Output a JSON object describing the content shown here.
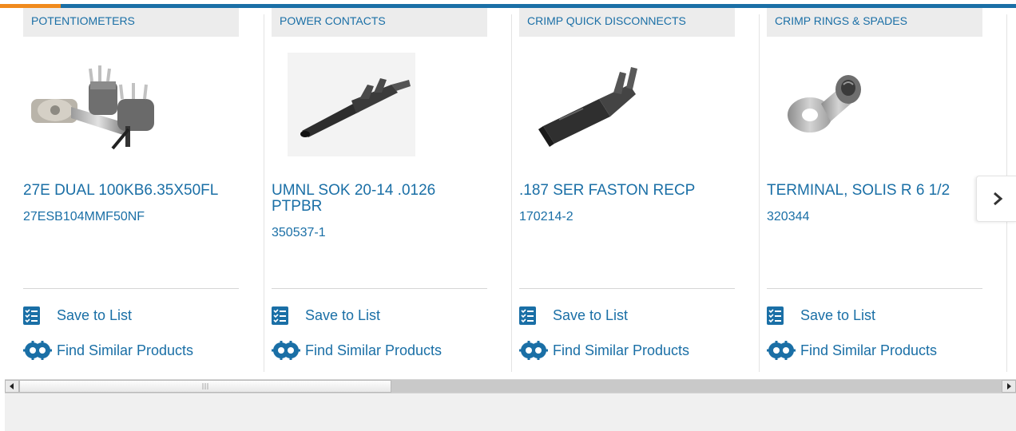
{
  "colors": {
    "accent": "#1a6fa6",
    "highlight": "#f08a1d"
  },
  "cards": [
    {
      "category": "POTENTIOMETERS",
      "title": "27E DUAL 100KB6.35X50FL",
      "part_number": "27ESB104MMF50NF",
      "image_icon": "potentiometer-image",
      "save_label": "Save to List",
      "find_label": "Find Similar Products"
    },
    {
      "category": "POWER CONTACTS",
      "title": "UMNL SOK 20-14 .0126 PTPBR",
      "part_number": "350537-1",
      "image_icon": "power-contact-image",
      "save_label": "Save to List",
      "find_label": "Find Similar Products"
    },
    {
      "category": "CRIMP QUICK DISCONNECTS",
      "title": ".187 SER FASTON RECP",
      "part_number": "170214-2",
      "image_icon": "faston-receptacle-image",
      "save_label": "Save to List",
      "find_label": "Find Similar Products"
    },
    {
      "category": "CRIMP RINGS & SPADES",
      "title": "TERMINAL, SOLIS R 6 1/2",
      "part_number": "320344",
      "image_icon": "ring-terminal-image",
      "save_label": "Save to List",
      "find_label": "Find Similar Products"
    }
  ],
  "next_arrow": {
    "icon": "chevron-right-icon"
  },
  "scrollbar": {
    "left_icon": "scroll-left-arrow-icon",
    "right_icon": "scroll-right-arrow-icon"
  }
}
